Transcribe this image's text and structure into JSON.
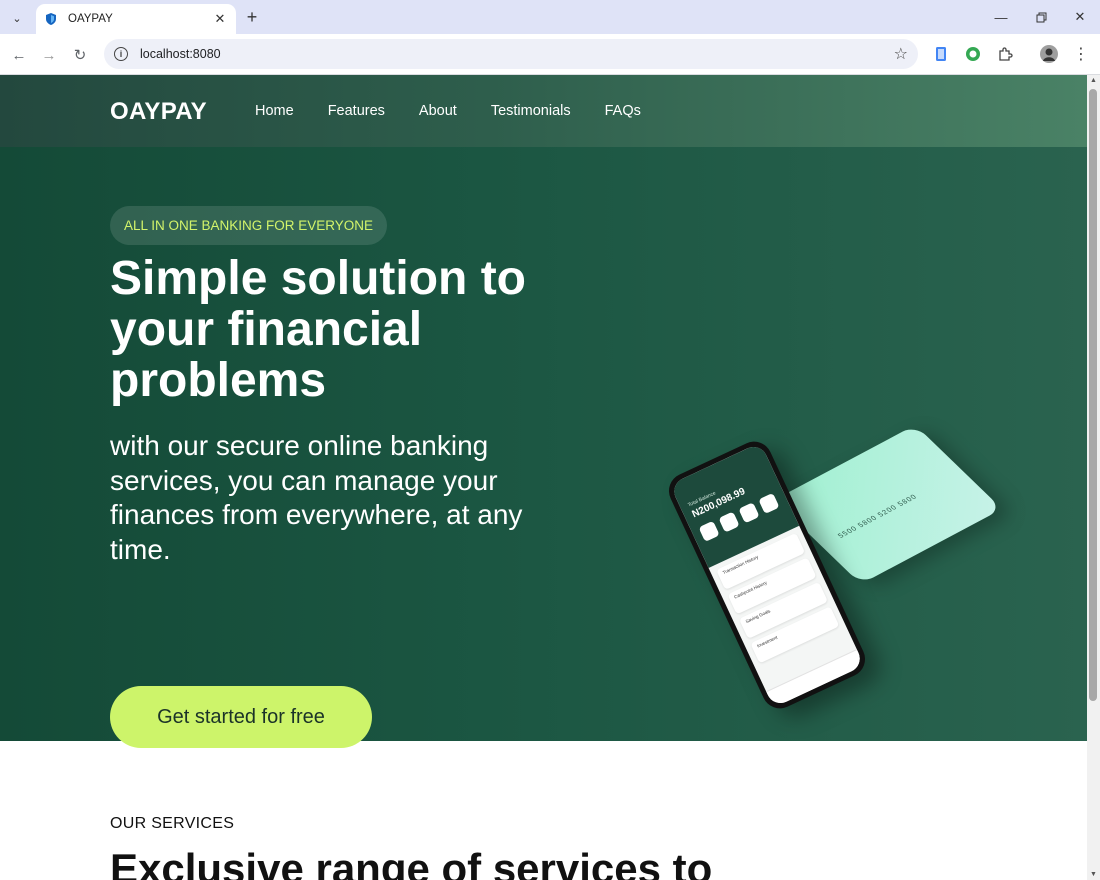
{
  "browser": {
    "tab_title": "OAYPAY",
    "new_tab": "+",
    "url": "localhost:8080"
  },
  "site": {
    "logo": "OAYPAY",
    "nav": [
      {
        "label": "Home"
      },
      {
        "label": "Features"
      },
      {
        "label": "About"
      },
      {
        "label": "Testimonials"
      },
      {
        "label": "FAQs"
      }
    ]
  },
  "hero": {
    "badge": "ALL IN ONE BANKING FOR EVERYONE",
    "title": "Simple solution to your financial problems",
    "subtitle": "with our secure online banking services, you can manage your finances from everywhere, at any time.",
    "cta": "Get started for free",
    "phone": {
      "balance_label": "Total Balance",
      "balance": "N200,098.99",
      "rows": [
        "Transaction History",
        "Cashpoint History",
        "Saving Goals",
        "Investment"
      ]
    },
    "card_number": "5500 5800 5200 5800"
  },
  "services": {
    "label": "OUR SERVICES",
    "title": "Exclusive range of services to"
  },
  "colors": {
    "hero_bg": "#1b5642",
    "accent": "#cdf46a",
    "badge_text": "#d3f46a"
  }
}
